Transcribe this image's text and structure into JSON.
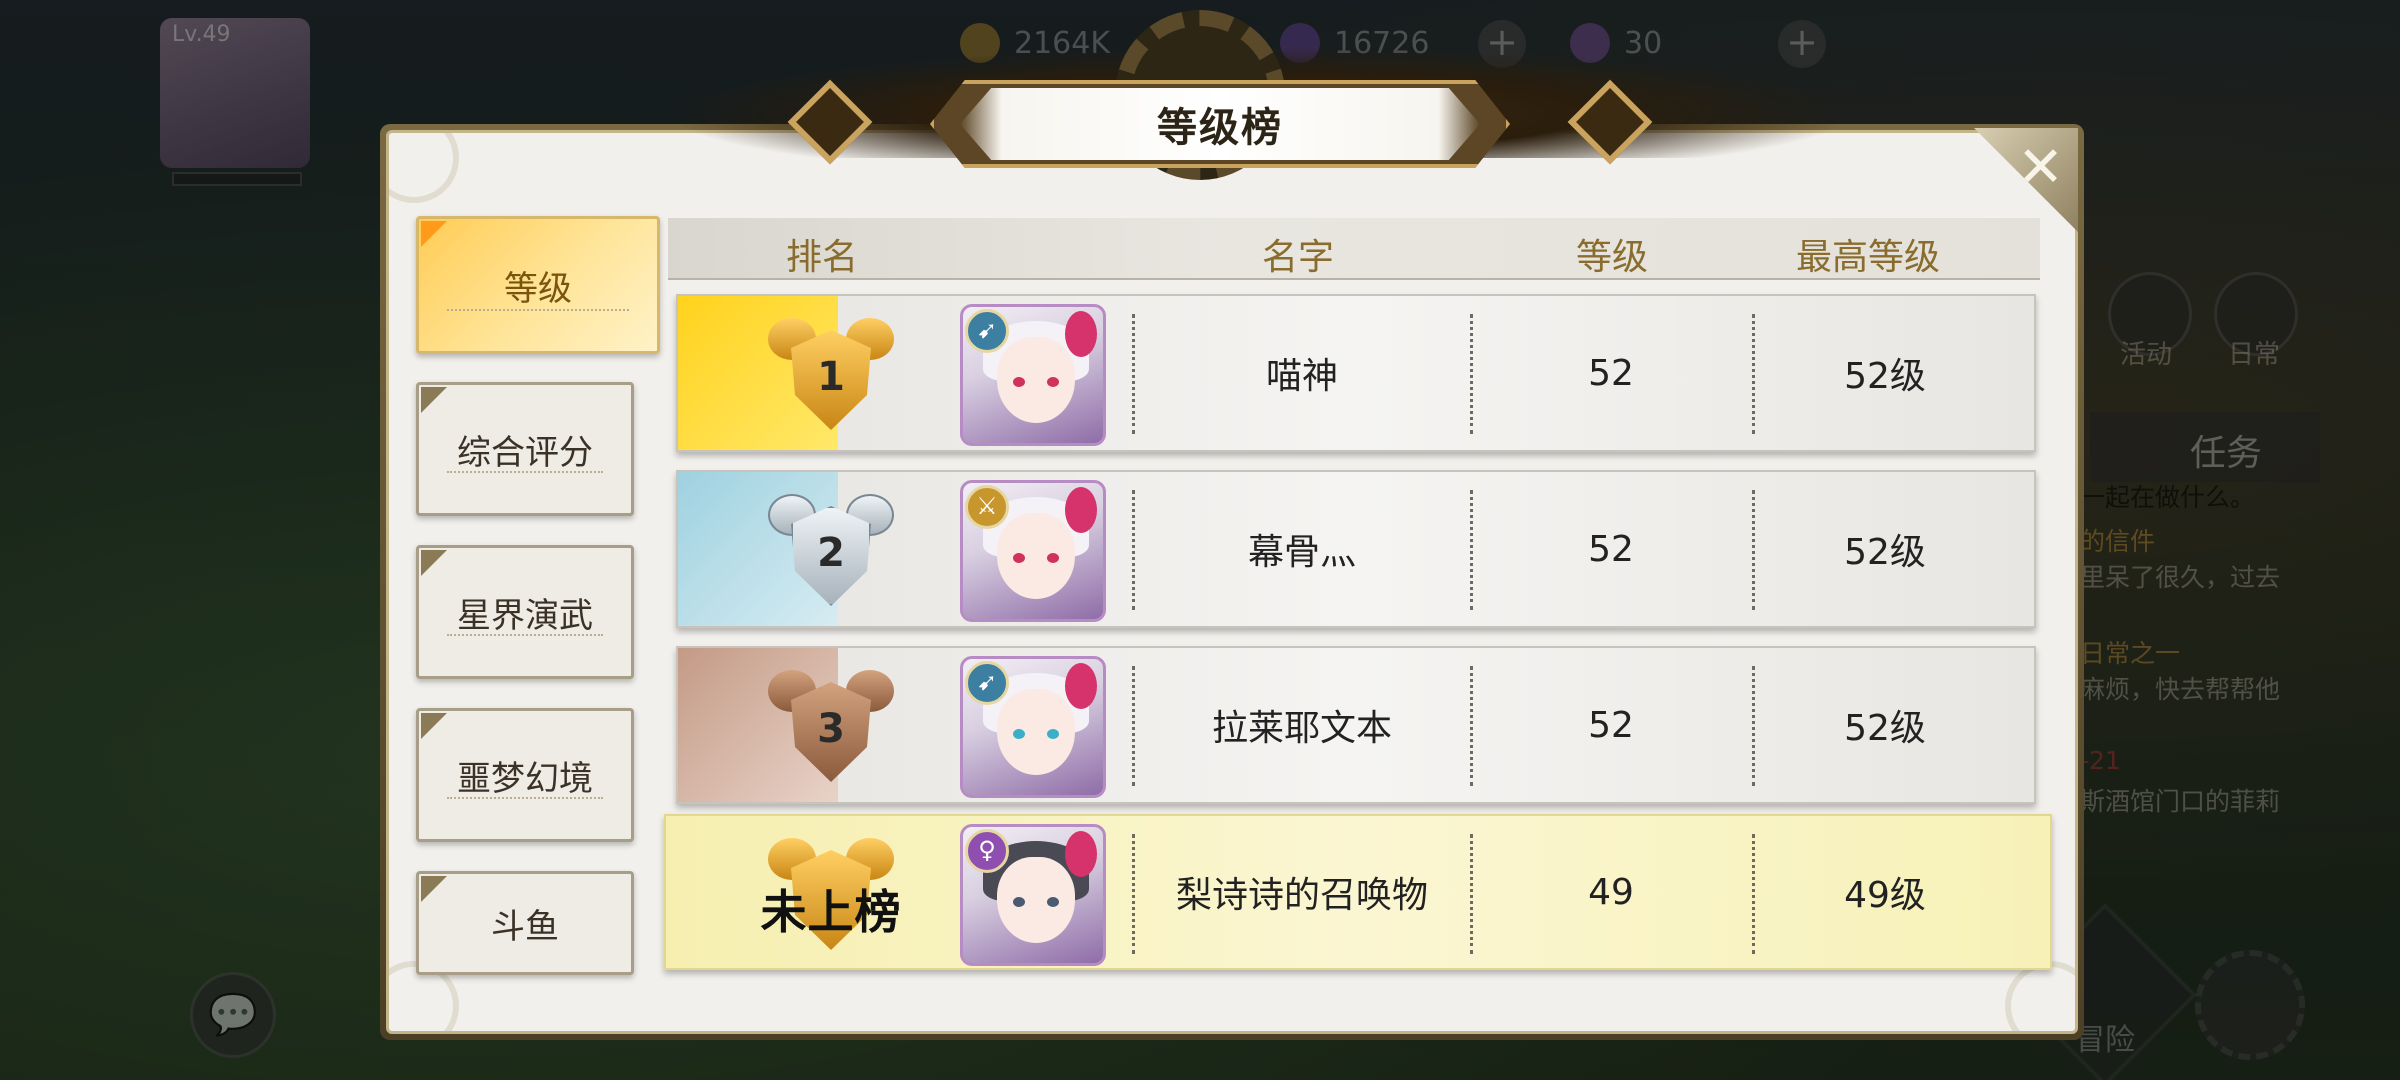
{
  "hud": {
    "player_level": "Lv.49",
    "gold": "2164K",
    "gems": "16726",
    "stamina": "30"
  },
  "side": {
    "activity_label": "活动",
    "daily_label": "日常",
    "task_tab": "任务",
    "quests": [
      {
        "text": "一起在做什么。",
        "color": "#bdb7a7"
      },
      {
        "text": "的信件",
        "color": "#d9a441"
      },
      {
        "text": "里呆了很久，过去",
        "color": "#bdb7a7"
      },
      {
        "text": "日常之一",
        "color": "#d9a441"
      },
      {
        "text": "麻烦，快去帮帮他",
        "color": "#bdb7a7"
      },
      {
        "text": "-21",
        "color": "#cc3b3b"
      },
      {
        "text": "斯酒馆门口的菲莉",
        "color": "#bdb7a7"
      }
    ],
    "adventure_label": "冒险"
  },
  "modal": {
    "title": "等级榜",
    "close_symbol": "✕",
    "tabs": [
      {
        "label": "等级",
        "active": true
      },
      {
        "label": "综合评分",
        "active": false
      },
      {
        "label": "星界演武",
        "active": false
      },
      {
        "label": "噩梦幻境",
        "active": false
      },
      {
        "label": "斗鱼",
        "active": false
      }
    ],
    "columns": {
      "rank": "排名",
      "name": "名字",
      "level": "等级",
      "max_level": "最高等级"
    },
    "rows": [
      {
        "rank": "1",
        "medal": "gold",
        "name": "喵神",
        "level": "52",
        "max_level": "52级",
        "class_color": "#3c7fa0"
      },
      {
        "rank": "2",
        "medal": "silver",
        "name": "幕骨灬",
        "level": "52",
        "max_level": "52级",
        "class_color": "#c7962c"
      },
      {
        "rank": "3",
        "medal": "bronze",
        "name": "拉莱耶文本",
        "level": "52",
        "max_level": "52级",
        "class_color": "#3c7fa0"
      }
    ],
    "self_row": {
      "rank": "未上榜",
      "name": "梨诗诗的召唤物",
      "level": "49",
      "max_level": "49级",
      "class_color": "#8f4fb0"
    }
  }
}
